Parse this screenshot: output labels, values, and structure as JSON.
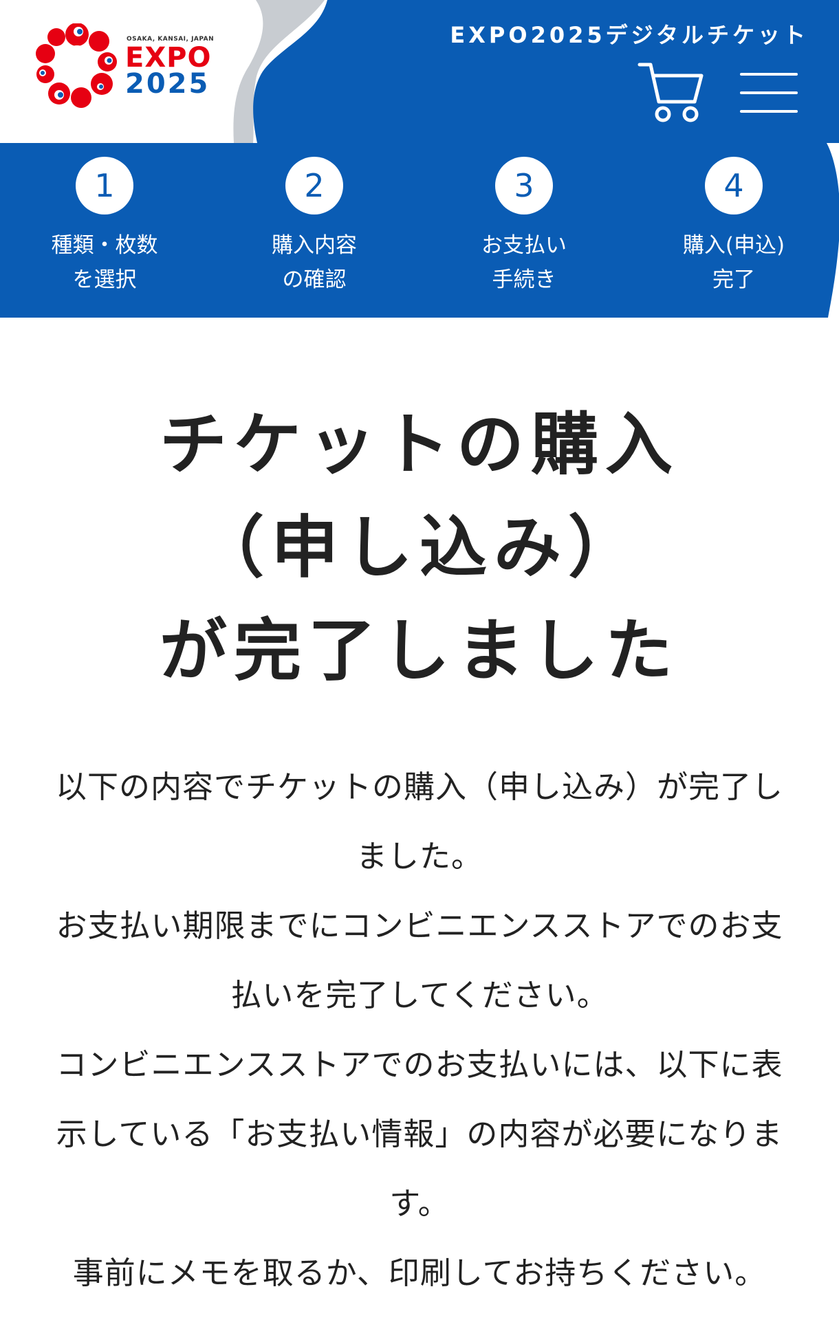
{
  "header": {
    "logo": {
      "small_text": "OSAKA, KANSAI, JAPAN",
      "expo_text": "EXPO",
      "year_text": "2025"
    },
    "title": "EXPO2025デジタルチケット",
    "cart_icon": "cart-icon",
    "menu_icon": "hamburger-menu-icon"
  },
  "steps": [
    {
      "number": "1",
      "line1": "種類・枚数",
      "line2": "を選択"
    },
    {
      "number": "2",
      "line1": "購入内容",
      "line2": "の確認"
    },
    {
      "number": "3",
      "line1": "お支払い",
      "line2": "手続き"
    },
    {
      "number": "4",
      "line1": "購入(申込)",
      "line2": "完了"
    }
  ],
  "main": {
    "title_lines": [
      "チケットの購入",
      "（申し込み）",
      "が完了しました"
    ],
    "paragraphs": [
      "以下の内容でチケットの購入（申し込み）が完了しました。",
      "お支払い期限までにコンビニエンスストアでのお支払いを完了してください。",
      "コンビニエンスストアでのお支払いには、以下に表示している「お支払い情報」の内容が必要になります。",
      "事前にメモを取るか、印刷してお持ちください。"
    ]
  },
  "colors": {
    "primary_blue": "#0a5cb4",
    "expo_red": "#e60012",
    "text": "#222222",
    "wave_gray": "#c8ccd1"
  }
}
